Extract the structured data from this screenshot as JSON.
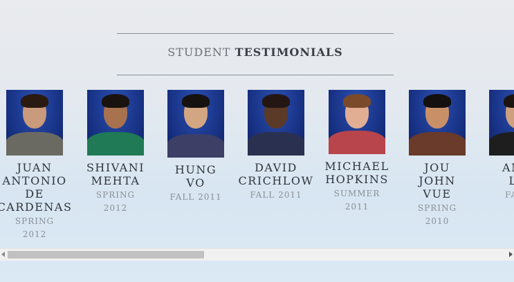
{
  "section": {
    "title_light": "STUDENT",
    "title_bold": "TESTIMONIALS"
  },
  "students": [
    {
      "name_lines": [
        "JUAN",
        "ANTONIO",
        "DE",
        "CARDENAS"
      ],
      "term_lines": [
        "SPRING",
        "2012"
      ],
      "skin": "#c99a7c",
      "hair": "#2a1a12",
      "shirt": "#6b6a62"
    },
    {
      "name_lines": [
        "SHIVANI",
        "MEHTA"
      ],
      "term_lines": [
        "SPRING",
        "2012"
      ],
      "skin": "#a8724f",
      "hair": "#1a120e",
      "shirt": "#1f7a55"
    },
    {
      "name_lines": [
        "HUNG",
        "VO"
      ],
      "term_lines": [
        "FALL 2011"
      ],
      "skin": "#d3a683",
      "hair": "#161210",
      "shirt": "#3d3f66"
    },
    {
      "name_lines": [
        "DAVID",
        "CRICHLOW"
      ],
      "term_lines": [
        "FALL 2011"
      ],
      "skin": "#5b3a28",
      "hair": "#241612",
      "shirt": "#2a3050"
    },
    {
      "name_lines": [
        "MICHAEL",
        "HOPKINS"
      ],
      "term_lines": [
        "SUMMER",
        "2011"
      ],
      "skin": "#e1ae94",
      "hair": "#7a4a2a",
      "shirt": "#b8444c"
    },
    {
      "name_lines": [
        "JOU",
        "JOHN",
        "VUE"
      ],
      "term_lines": [
        "SPRING",
        "2010"
      ],
      "skin": "#c99067",
      "hair": "#141010",
      "shirt": "#6a3a2a"
    },
    {
      "name_lines": [
        "AMA",
        "LA"
      ],
      "term_lines": [
        "FALL"
      ],
      "skin": "#cfa07f",
      "hair": "#1c1410",
      "shirt": "#1e1e1e"
    }
  ],
  "scrollbar": {
    "left_arrow_icon": "arrow-left-icon",
    "right_arrow_icon": "arrow-right-icon"
  }
}
